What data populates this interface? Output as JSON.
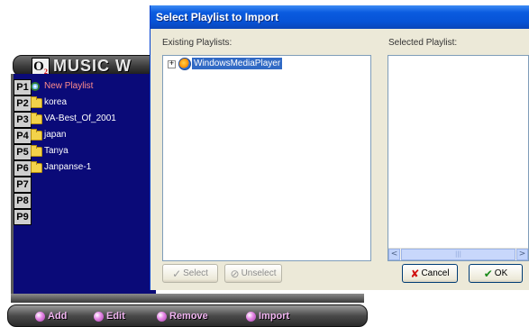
{
  "app": {
    "logo_text": "O",
    "logo_sub": "2",
    "title": "MUSIC W",
    "playlists": [
      {
        "num": "P1",
        "icon": "disc-icon",
        "label": "New Playlist",
        "active": true
      },
      {
        "num": "P2",
        "icon": "folder-icon",
        "label": "korea"
      },
      {
        "num": "P3",
        "icon": "folder-icon",
        "label": "VA-Best_Of_2001"
      },
      {
        "num": "P4",
        "icon": "folder-icon",
        "label": "japan"
      },
      {
        "num": "P5",
        "icon": "folder-icon",
        "label": "Tanya"
      },
      {
        "num": "P6",
        "icon": "folder-icon",
        "label": "Janpanse-1"
      },
      {
        "num": "P7",
        "label": ""
      },
      {
        "num": "P8",
        "label": ""
      },
      {
        "num": "P9",
        "label": ""
      }
    ],
    "bottom_buttons": [
      "Add",
      "Edit",
      "Remove",
      "Import"
    ]
  },
  "dialog": {
    "title": "Select Playlist to Import",
    "existing_label": "Existing Playlists:",
    "selected_label": "Selected Playlist:",
    "tree_expander": "+",
    "tree_item": "WindowsMediaPlayer",
    "scroll_left": "<",
    "scroll_right": ">",
    "scroll_thumb": "|||",
    "buttons": {
      "select": "Select",
      "unselect": "Unselect",
      "cancel": "Cancel",
      "ok": "OK"
    }
  },
  "colors": {
    "titlebar": "#0753d6",
    "panel": "#0a0a78",
    "selection": "#316ac5",
    "active_playlist": "#ff8c8c"
  }
}
